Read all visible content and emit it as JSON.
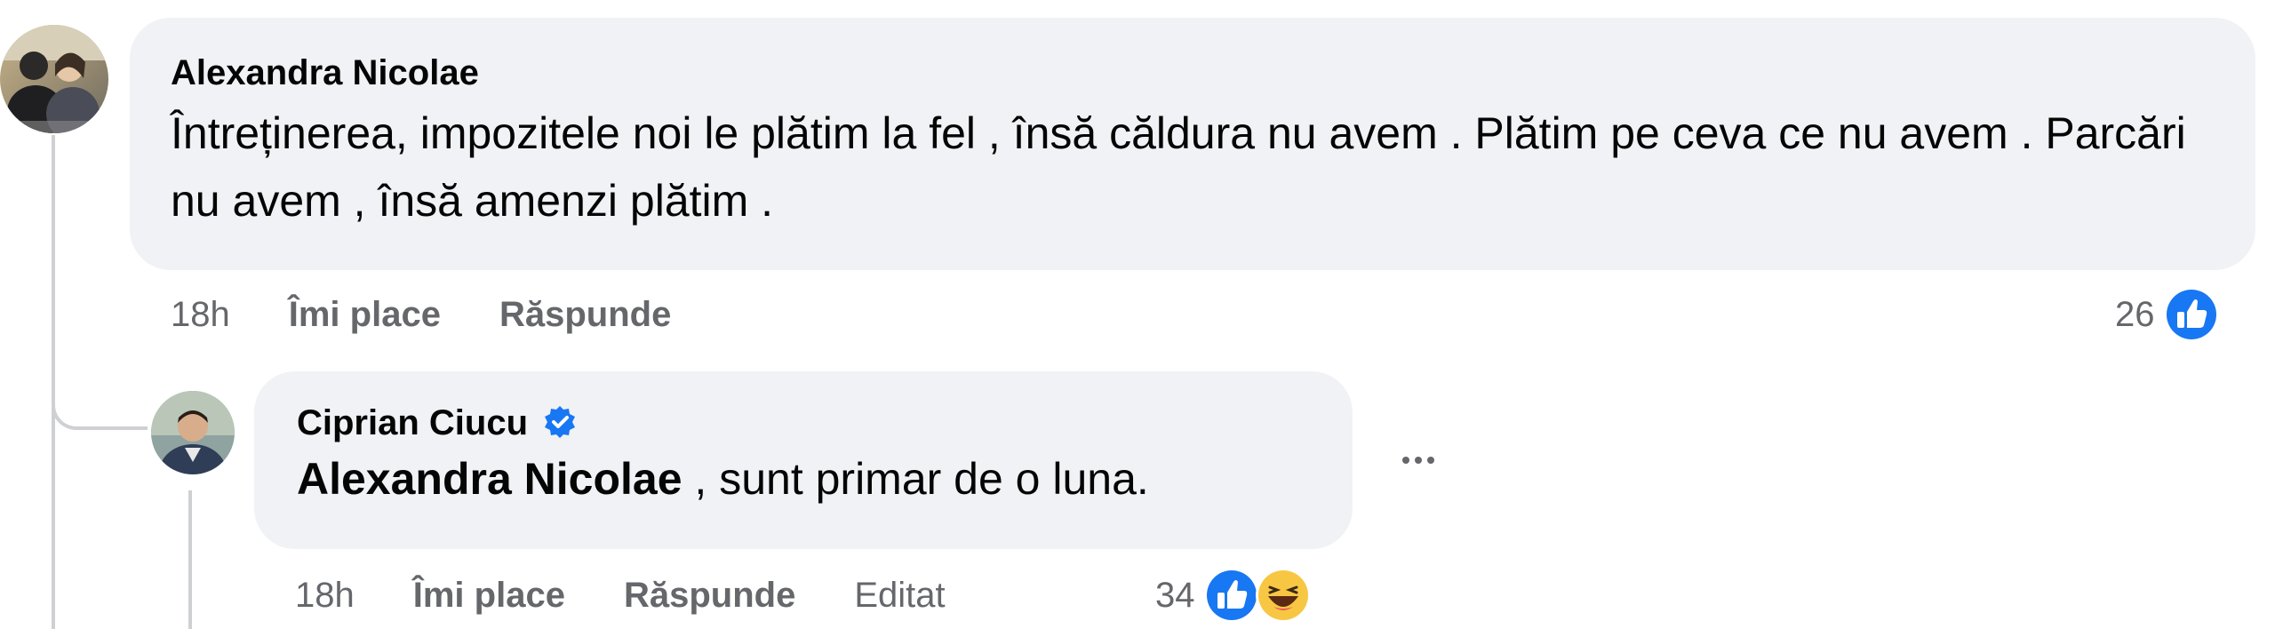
{
  "comment": {
    "author": "Alexandra Nicolae",
    "text": "Întreținerea, impozitele noi le plătim la fel , însă căldura nu avem . Plătim pe ceva ce nu avem . Parcări nu avem , însă amenzi plătim .",
    "time": "18h",
    "like_label": "Îmi place",
    "reply_label": "Răspunde",
    "reaction_count": "26",
    "reactions": [
      "like-icon"
    ]
  },
  "reply": {
    "author": "Ciprian Ciucu",
    "verified": true,
    "mention": "Alexandra Nicolae",
    "text": " , sunt primar de o luna.",
    "time": "18h",
    "like_label": "Îmi place",
    "reply_label": "Răspunde",
    "edited_label": "Editat",
    "reaction_count": "34",
    "reactions": [
      "like-icon",
      "haha-icon"
    ]
  },
  "colors": {
    "bubble": "#f0f2f5",
    "meta_text": "#65676b",
    "like_blue": "#1877f2",
    "thread_line": "#ced0d4"
  }
}
